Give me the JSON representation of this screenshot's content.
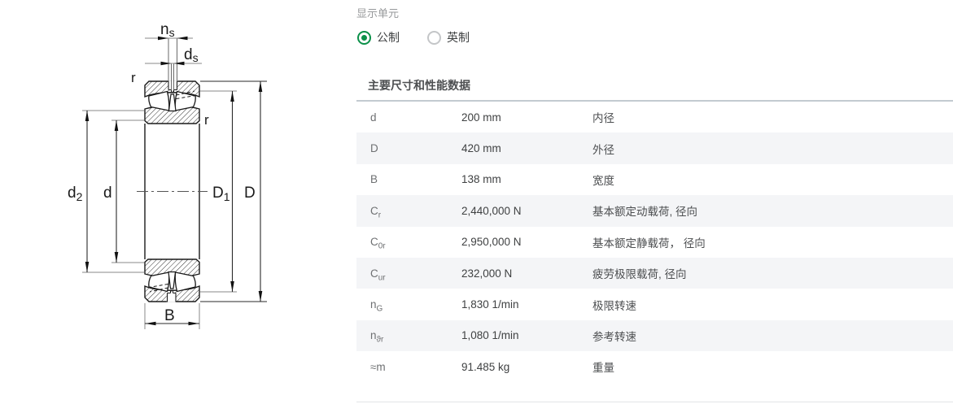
{
  "unit_selector": {
    "label": "显示单元",
    "options": [
      {
        "label": "公制",
        "selected": true
      },
      {
        "label": "英制",
        "selected": false
      }
    ]
  },
  "section": {
    "title": "主要尺寸和性能数据",
    "rows": [
      {
        "symbol": "d",
        "sub": "",
        "value": "200 mm",
        "description": "内径"
      },
      {
        "symbol": "D",
        "sub": "",
        "value": "420 mm",
        "description": "外径"
      },
      {
        "symbol": "B",
        "sub": "",
        "value": "138 mm",
        "description": "宽度"
      },
      {
        "symbol": "C",
        "sub": "r",
        "value": "2,440,000 N",
        "description": "基本额定动载荷, 径向"
      },
      {
        "symbol": "C",
        "sub": "0r",
        "value": "2,950,000 N",
        "description": "基本额定静载荷， 径向"
      },
      {
        "symbol": "C",
        "sub": "ur",
        "value": "232,000 N",
        "description": "疲劳极限载荷, 径向"
      },
      {
        "symbol": "n",
        "sub": "G",
        "value": "1,830 1/min",
        "description": "极限转速"
      },
      {
        "symbol": "n",
        "sub": "ϑr",
        "value": "1,080 1/min",
        "description": "参考转速"
      },
      {
        "symbol": "≈m",
        "sub": "",
        "value": "91.485 kg",
        "description": "重量"
      }
    ]
  },
  "diagram": {
    "labels": {
      "ns": {
        "base": "n",
        "sub": "s"
      },
      "ds": {
        "base": "d",
        "sub": "s"
      },
      "r_top": "r",
      "r_right": "r",
      "d2": {
        "base": "d",
        "sub": "2"
      },
      "d": "d",
      "D1": {
        "base": "D",
        "sub": "1"
      },
      "D": "D",
      "B": "B"
    }
  },
  "colors": {
    "accent_green": "#0b9049",
    "table_stripe": "#f4f5f7",
    "table_top_border": "#c3cbd0",
    "drawing_line": "#1a1a1a",
    "dimension_line": "#8a8a8a"
  }
}
